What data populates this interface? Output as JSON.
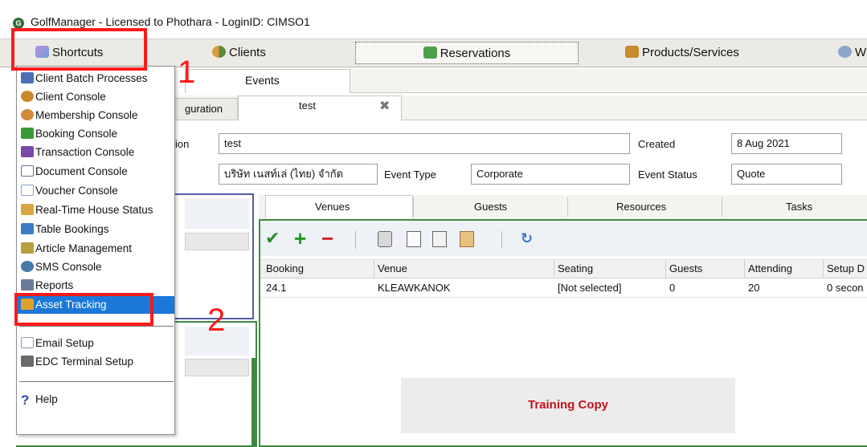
{
  "window": {
    "title": "GolfManager - Licensed to Phothara - LoginID: CIMSO1"
  },
  "main_tabs": [
    {
      "label": "Shortcuts",
      "icon": "shortcuts-icon"
    },
    {
      "label": "Clients",
      "icon": "clients-icon"
    },
    {
      "label": "Reservations",
      "icon": "reservations-icon"
    },
    {
      "label": "Products/Services",
      "icon": "products-icon"
    },
    {
      "label": "W",
      "icon": "stopwatch-icon"
    }
  ],
  "sub_tabs": {
    "events": "Events",
    "configuration": "guration",
    "test": "test",
    "close_glyph": "✖"
  },
  "form": {
    "description_label": "ion",
    "description_value": "test",
    "created_label": "Created",
    "created_value": "8 Aug 2021",
    "company_value": "บริษัท เนสท์เล่ (ไทย) จำกัด",
    "event_type_label": "Event Type",
    "event_type_value": "Corporate",
    "event_status_label": "Event Status",
    "event_status_value": "Quote"
  },
  "venue_tabs": [
    "Venues",
    "Guests",
    "Resources",
    "Tasks"
  ],
  "grid": {
    "columns": [
      "Booking",
      "Venue",
      "Seating",
      "Guests",
      "Attending",
      "Setup D"
    ],
    "rows": [
      [
        "24.1",
        "KLEAWKANOK",
        "[Not selected]",
        "0",
        "20",
        "0 secon"
      ]
    ]
  },
  "training_label": "Training Copy",
  "menu": {
    "items": [
      {
        "label": "Client Batch Processes",
        "icon": "batch-process-icon",
        "color": "#4a6fb5"
      },
      {
        "label": "Client Console",
        "icon": "clients-icon",
        "color": "#c98a2c"
      },
      {
        "label": "Membership Console",
        "icon": "membership-icon",
        "color": "#d28b3a"
      },
      {
        "label": "Booking Console",
        "icon": "booking-icon",
        "color": "#3a9a3a"
      },
      {
        "label": "Transaction Console",
        "icon": "transaction-icon",
        "color": "#7a4aa8"
      },
      {
        "label": "Document Console",
        "icon": "document-icon",
        "color": "#5a6f9a"
      },
      {
        "label": "Voucher Console",
        "icon": "voucher-icon",
        "color": "#8aa0c8"
      },
      {
        "label": "Real-Time House Status",
        "icon": "house-status-icon",
        "color": "#d8a640"
      },
      {
        "label": "Table Bookings",
        "icon": "table-icon",
        "color": "#3b7ac4"
      },
      {
        "label": "Article Management",
        "icon": "article-icon",
        "color": "#b8a040"
      },
      {
        "label": "SMS Console",
        "icon": "sms-icon",
        "color": "#4a7aa8"
      },
      {
        "label": "Reports",
        "icon": "reports-icon",
        "color": "#6a7a9a"
      },
      {
        "label": "Asset Tracking",
        "icon": "asset-tracking-icon",
        "color": "#e0a030"
      },
      {
        "label": "Email Setup",
        "icon": "email-icon",
        "color": "#8a9ab8"
      },
      {
        "label": "EDC Terminal Setup",
        "icon": "edc-terminal-icon",
        "color": "#6a6a6a"
      },
      {
        "label": "Help",
        "icon": "help-icon",
        "color": "#2a4aa8"
      }
    ],
    "selected": "Asset Tracking"
  },
  "annotations": {
    "step1": "1",
    "step2": "2",
    "color": "#ff1a1a"
  }
}
